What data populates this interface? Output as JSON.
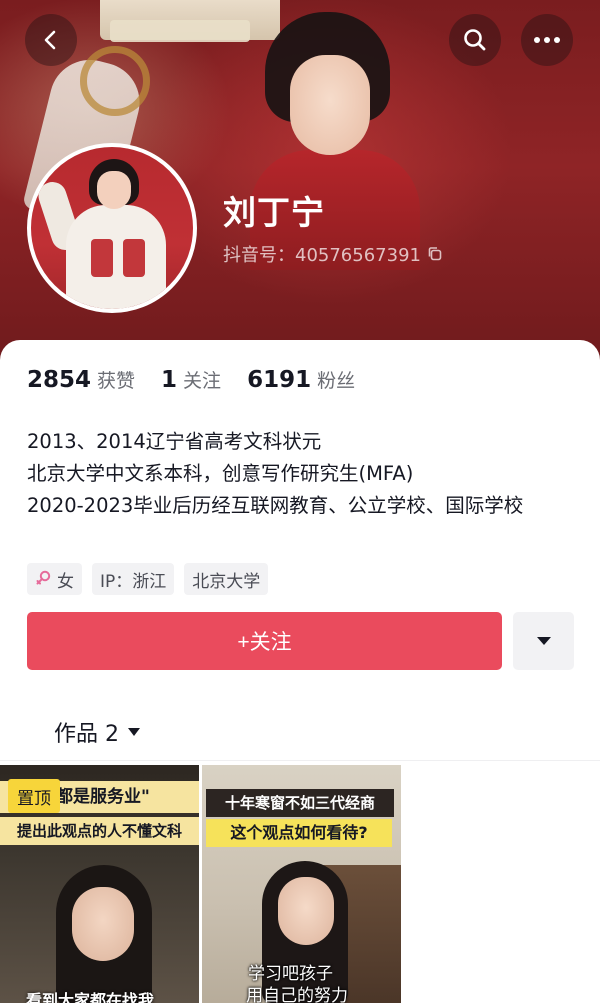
{
  "header": {
    "nickname": "刘丁宁",
    "douyin_id": "抖音号：40576567391"
  },
  "stats": [
    {
      "value": "2854",
      "label": "获赞"
    },
    {
      "value": "1",
      "label": "关注"
    },
    {
      "value": "6191",
      "label": "粉丝"
    }
  ],
  "bio": {
    "line1": "2013、2014辽宁省高考文科状元",
    "line2": "北京大学中文系本科，创意写作研究生(MFA)",
    "line3": "2020-2023毕业后历经互联网教育、公立学校、国际学校"
  },
  "tags": {
    "gender": "女",
    "ip": "IP：浙江",
    "school": "北京大学"
  },
  "actions": {
    "follow_label": "+关注"
  },
  "tabs": {
    "works_label": "作品 2"
  },
  "videos": [
    {
      "pinned": "置顶",
      "title_top": "都是服务业\"",
      "title_bottom": "提出此观点的人不懂文科",
      "caption": "看到大家都在找我"
    },
    {
      "title_top": "十年寒窗不如三代经商",
      "title_bottom": "这个观点如何看待?",
      "caption1": "学习吧孩子",
      "caption2": "用自己的努力"
    }
  ],
  "colors": {
    "header_bg": "#8f2426",
    "follow_button": "#ea4b5d",
    "gender_icon": "#e66b9a"
  },
  "icons": [
    "back-icon",
    "search-icon",
    "more-icon",
    "copy-icon",
    "female-icon",
    "caret-down-icon"
  ]
}
